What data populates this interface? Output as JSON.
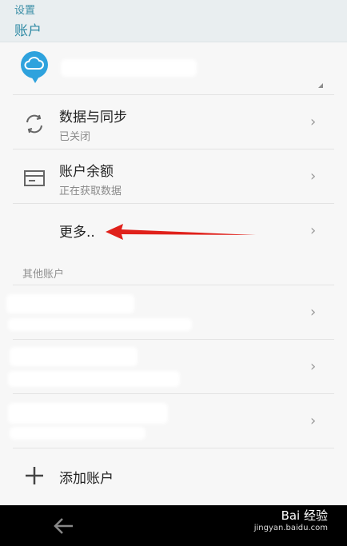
{
  "header": {
    "crumb": "设置",
    "title": "账户"
  },
  "account": {
    "avatar_color": "#2ea2dd"
  },
  "rows": [
    {
      "label": "数据与同步",
      "sub": "已关闭",
      "icon": "sync-icon"
    },
    {
      "label": "账户余额",
      "sub": "正在获取数据",
      "icon": "wallet-icon"
    },
    {
      "label": "更多..",
      "icon": "none"
    }
  ],
  "section": {
    "other_accounts": "其他账户"
  },
  "add_account": {
    "label": "添加账户",
    "icon": "plus-icon"
  },
  "watermark": {
    "brand": "Bai 经验",
    "url": "jingyan.baidu.com"
  },
  "colors": {
    "accent": "#2f8aa4",
    "arrow": "#e0211b"
  }
}
